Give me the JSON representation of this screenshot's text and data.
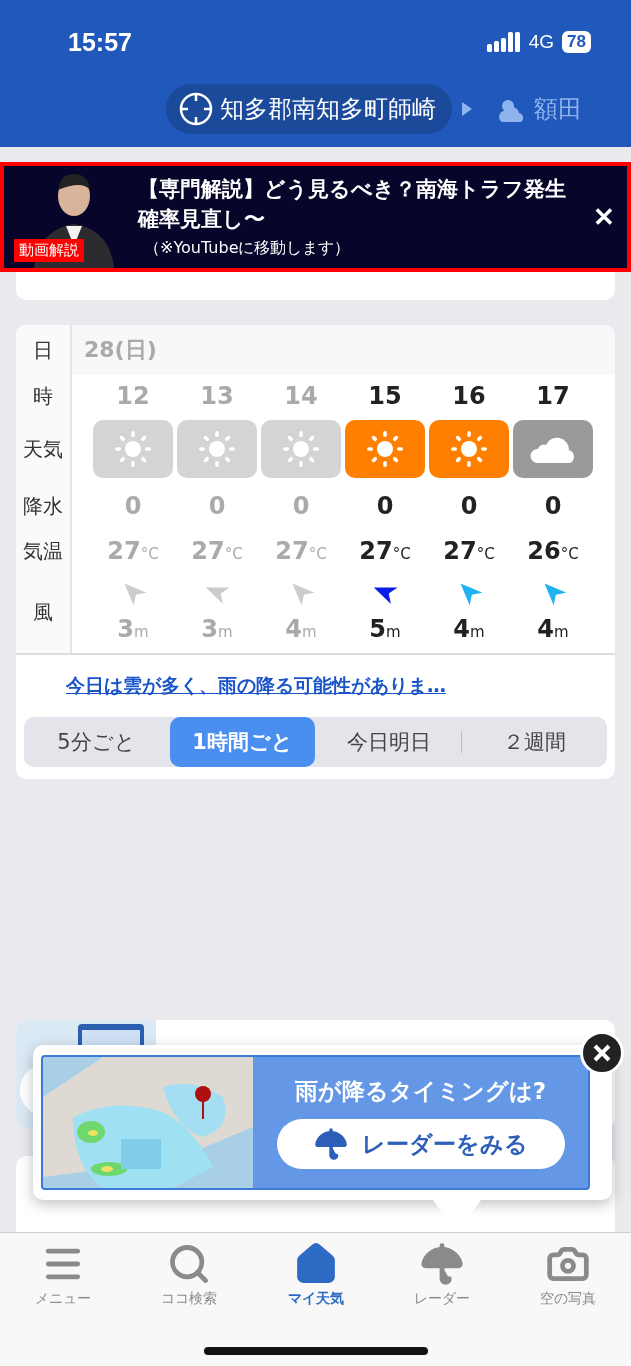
{
  "status_bar": {
    "time": "15:57",
    "network": "4G",
    "battery": "78"
  },
  "locations": [
    {
      "name": "知多郡南知多町師崎",
      "selected": true
    },
    {
      "name": "額田",
      "selected": false
    }
  ],
  "news_banner": {
    "badge": "動画解説",
    "title": "【専門解説】どう見るべき？南海トラフ発生確率見直し〜",
    "note": "（※YouTubeに移動します）",
    "close": "✕"
  },
  "hourly": {
    "row_labels": {
      "date": "日",
      "hour": "時",
      "weather": "天気",
      "rain": "降水",
      "temp": "気温",
      "wind": "風"
    },
    "date": "28(日)",
    "hours": [
      {
        "hour": "12",
        "past": true,
        "weather": {
          "kind": "sun"
        },
        "rain": "0",
        "temp": "27",
        "temp_unit": "°C",
        "wind": {
          "kind": "nw",
          "speed": "3",
          "unit": "m",
          "color": "#cccccc"
        }
      },
      {
        "hour": "13",
        "past": true,
        "weather": {
          "kind": "sun"
        },
        "rain": "0",
        "temp": "27",
        "temp_unit": "°C",
        "wind": {
          "kind": "wnw",
          "speed": "3",
          "unit": "m",
          "color": "#cccccc"
        }
      },
      {
        "hour": "14",
        "past": true,
        "weather": {
          "kind": "sun"
        },
        "rain": "0",
        "temp": "27",
        "temp_unit": "°C",
        "wind": {
          "kind": "nw",
          "speed": "4",
          "unit": "m",
          "color": "#cccccc"
        }
      },
      {
        "hour": "15",
        "past": false,
        "weather": {
          "kind": "sun"
        },
        "rain": "0",
        "temp": "27",
        "temp_unit": "°C",
        "wind": {
          "kind": "wnw",
          "speed": "5",
          "unit": "m",
          "color": "#0a1ee6"
        }
      },
      {
        "hour": "16",
        "past": false,
        "weather": {
          "kind": "sun"
        },
        "rain": "0",
        "temp": "27",
        "temp_unit": "°C",
        "wind": {
          "kind": "nw",
          "speed": "4",
          "unit": "m",
          "color": "#1eb4f0"
        }
      },
      {
        "hour": "17",
        "past": false,
        "weather": {
          "kind": "cloud"
        },
        "rain": "0",
        "temp": "26",
        "temp_unit": "°C",
        "wind": {
          "kind": "nw",
          "speed": "4",
          "unit": "m",
          "color": "#1eb4f0"
        }
      }
    ],
    "summary_link": "今日は雲が多く、雨の降る可能性がありま…",
    "modes": [
      {
        "label": "5分ごと",
        "selected": false
      },
      {
        "label": "1時間ごと",
        "selected": true
      },
      {
        "label": "今日明日",
        "selected": false
      },
      {
        "label": "２週間",
        "selected": false
      }
    ]
  },
  "radar_popup": {
    "title": "雨が降るタイミングは?",
    "button": "レーダーをみる"
  },
  "tab_bar": [
    {
      "label": "メニュー",
      "kind": "menu",
      "selected": false
    },
    {
      "label": "ココ検索",
      "kind": "search",
      "selected": false
    },
    {
      "label": "マイ天気",
      "kind": "home",
      "selected": true
    },
    {
      "label": "レーダー",
      "kind": "umbrella",
      "selected": false
    },
    {
      "label": "空の写真",
      "kind": "camera",
      "selected": false
    }
  ]
}
